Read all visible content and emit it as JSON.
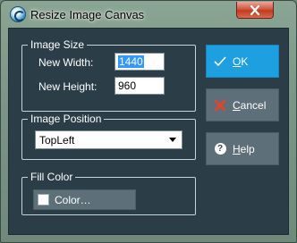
{
  "window": {
    "title": "Resize Image Canvas"
  },
  "image_size": {
    "legend": "Image Size",
    "width_label": "New Width:",
    "width_value": "1440",
    "height_label": "New Height:",
    "height_value": "960"
  },
  "image_position": {
    "legend": "Image Position",
    "selected": "TopLeft"
  },
  "fill_color": {
    "legend": "Fill Color",
    "button_label": "Color…",
    "swatch_color": "#ffffff"
  },
  "buttons": {
    "ok": {
      "mnemonic": "O",
      "rest": "K"
    },
    "cancel": {
      "mnemonic": "C",
      "rest": "ancel"
    },
    "help": {
      "mnemonic": "H",
      "rest": "elp"
    }
  },
  "colors": {
    "accent": "#1e9fe0",
    "panel": "#2b3e48",
    "button": "#5d6f78",
    "cancel_icon": "#e0452b"
  },
  "icons": {
    "app": "resize-canvas-icon",
    "close": "close-icon",
    "ok": "checkmark-icon",
    "cancel": "x-icon",
    "help": "question-icon",
    "dropdown": "chevron-down-icon"
  }
}
